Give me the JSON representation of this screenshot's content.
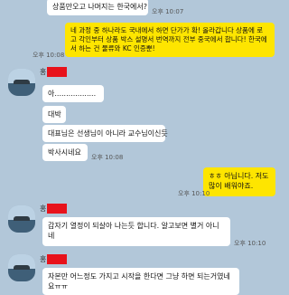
{
  "colors": {
    "background": "#b2c7d9",
    "my_bubble": "#fee500",
    "their_bubble": "#ffffff",
    "redaction": "#e8121b"
  },
  "messages": [
    {
      "side": "in",
      "text": "상품만오고 나머지는 한국에서?",
      "time": "오후 10:07"
    },
    {
      "side": "out",
      "text": "네 과정 중 하나라도 국내에서 하면 단가가 확! 올라갑니다 상품에 로고 각인부터 상품 박스 설명서 번역까지 전부 중국에서 합니다! 한국에서 하는 건 물류와 KC 인증뿐!",
      "time": "오후 10:08"
    },
    {
      "sender_initial": "홍",
      "text": "아..................",
      "side": "in"
    },
    {
      "side": "in",
      "text": "대박"
    },
    {
      "side": "in",
      "text": "대표님은 선생님이 아니라   교수님이신듯"
    },
    {
      "side": "in",
      "text": "박사시네요",
      "time": "오후 10:08"
    },
    {
      "side": "out",
      "text": "ㅎㅎ 아닙니다. 저도 많이 배워야죠.",
      "time": "오후 10:10"
    },
    {
      "sender_initial": "홍",
      "side": "in",
      "text": "갑자기 열정이 되살아 나는듯 합니다. 알고보면 별거 아니네",
      "time": "오후 10:10"
    },
    {
      "sender_initial": "홍",
      "side": "in",
      "text": "자본만 어느정도 가지고 시작을 한다면 그냥 하면 되는거였네요ㅠㅠ"
    }
  ]
}
